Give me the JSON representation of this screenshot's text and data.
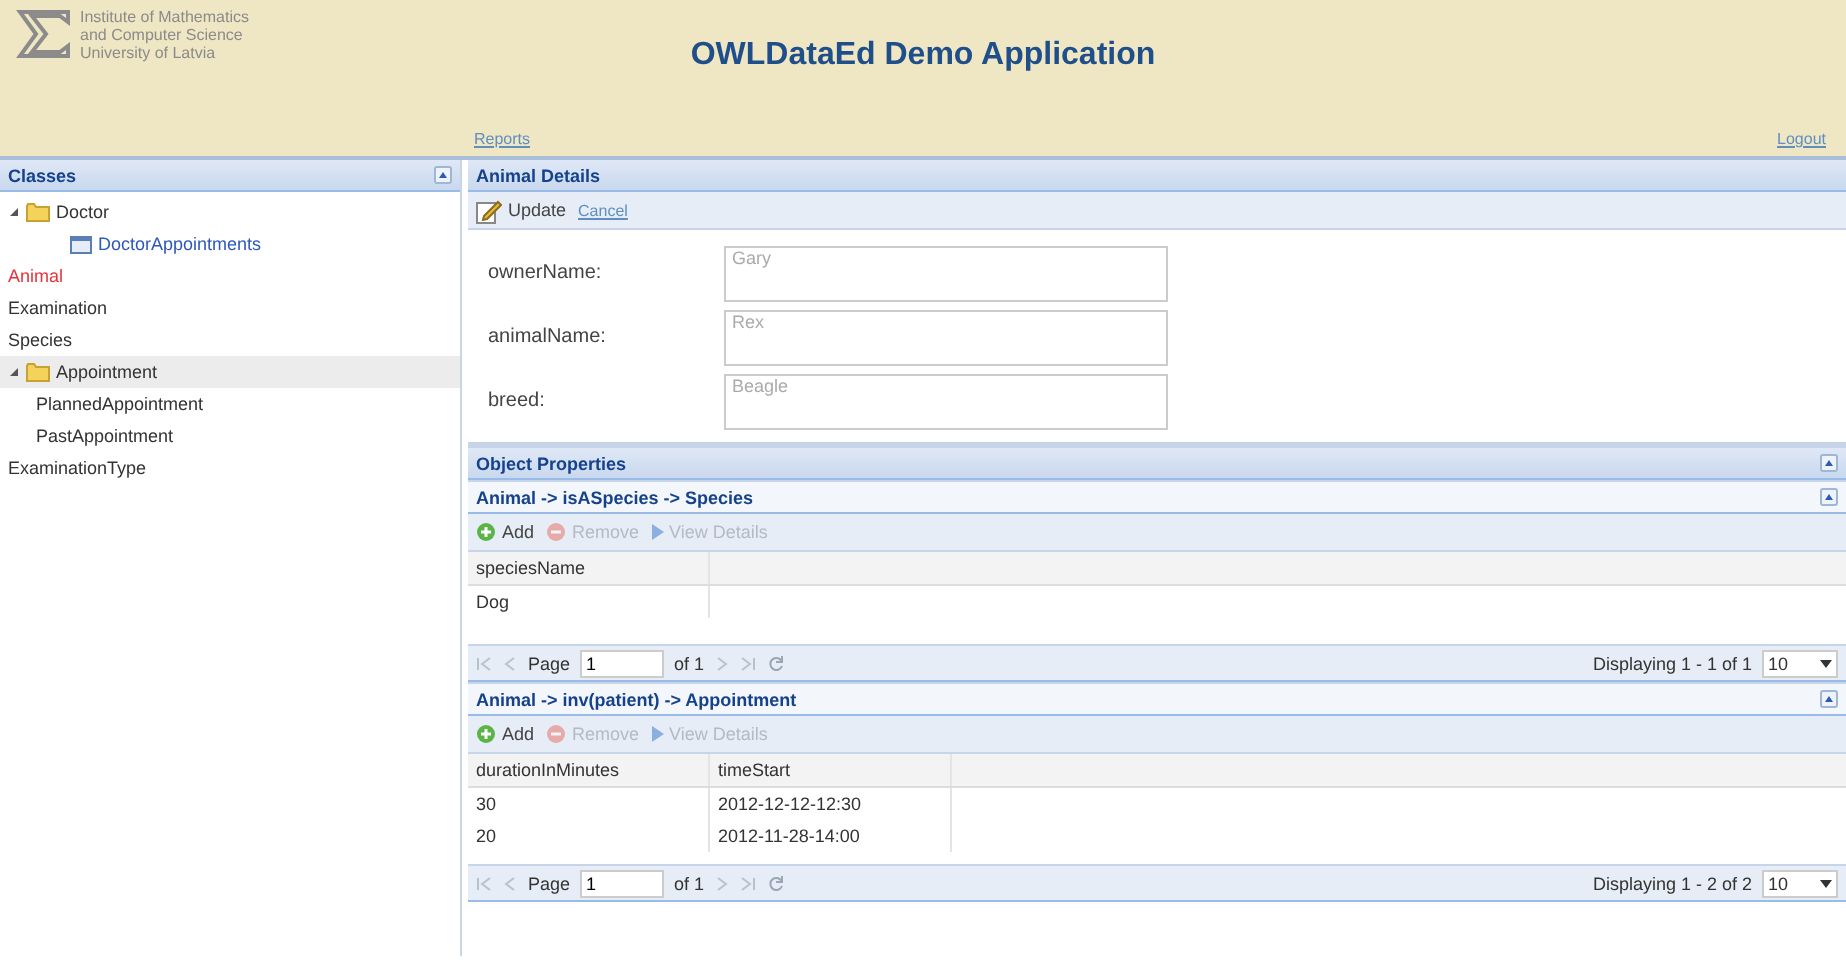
{
  "header": {
    "institute_lines": [
      "Institute of Mathematics",
      "and Computer Science",
      "University of Latvia"
    ],
    "title": "OWLDataEd Demo Application",
    "links": [
      "Reports",
      "Logout"
    ]
  },
  "classes_panel": {
    "title": "Classes",
    "items": [
      {
        "label": "Doctor",
        "kind": "folder",
        "expanded": true,
        "selected": false,
        "highlighted": false,
        "children": [
          {
            "label": "DoctorAppointments",
            "kind": "view",
            "selected": false,
            "highlighted": false
          }
        ]
      },
      {
        "label": "Animal",
        "kind": "class",
        "selected": true,
        "highlighted": false
      },
      {
        "label": "Examination",
        "kind": "class",
        "selected": false,
        "highlighted": false
      },
      {
        "label": "Species",
        "kind": "class",
        "selected": false,
        "highlighted": false
      },
      {
        "label": "Appointment",
        "kind": "folder",
        "expanded": true,
        "selected": false,
        "highlighted": true,
        "children": [
          {
            "label": "PlannedAppointment",
            "kind": "class",
            "selected": false,
            "highlighted": false
          },
          {
            "label": "PastAppointment",
            "kind": "class",
            "selected": false,
            "highlighted": false
          }
        ]
      },
      {
        "label": "ExaminationType",
        "kind": "class",
        "selected": false,
        "highlighted": false
      }
    ]
  },
  "details_panel": {
    "title": "Animal Details",
    "actions": [
      {
        "label": "Update",
        "kind": "button"
      },
      {
        "label": "Cancel",
        "kind": "link"
      }
    ],
    "fields": [
      {
        "label": "ownerName:",
        "value": "Gary"
      },
      {
        "label": "animalName:",
        "value": "Rex"
      },
      {
        "label": "breed:",
        "value": "Beagle"
      }
    ]
  },
  "object_properties": {
    "title": "Object Properties",
    "sections": [
      {
        "title": "Animal -> isASpecies -> Species",
        "actions": [
          {
            "label": "Add",
            "kind": "add",
            "disabled": false
          },
          {
            "label": "Remove",
            "kind": "remove",
            "disabled": true
          },
          {
            "label": "View Details",
            "kind": "view",
            "disabled": true
          }
        ],
        "columns": [
          "speciesName"
        ],
        "rows": [
          [
            "Dog"
          ]
        ],
        "pager": {
          "page_label": "Page",
          "page": "1",
          "of": "of 1",
          "display": "Displaying 1 - 1 of 1",
          "page_size": "10"
        }
      },
      {
        "title": "Animal -> inv(patient) -> Appointment",
        "actions": [
          {
            "label": "Add",
            "kind": "add",
            "disabled": false
          },
          {
            "label": "Remove",
            "kind": "remove",
            "disabled": true
          },
          {
            "label": "View Details",
            "kind": "view",
            "disabled": true
          }
        ],
        "columns": [
          "durationInMinutes",
          "timeStart"
        ],
        "rows": [
          [
            "30",
            "2012-12-12-12:30"
          ],
          [
            "20",
            "2012-11-28-14:00"
          ]
        ],
        "pager": {
          "page_label": "Page",
          "page": "1",
          "of": "of 1",
          "display": "Displaying 1 - 2 of 2",
          "page_size": "10"
        }
      }
    ]
  }
}
